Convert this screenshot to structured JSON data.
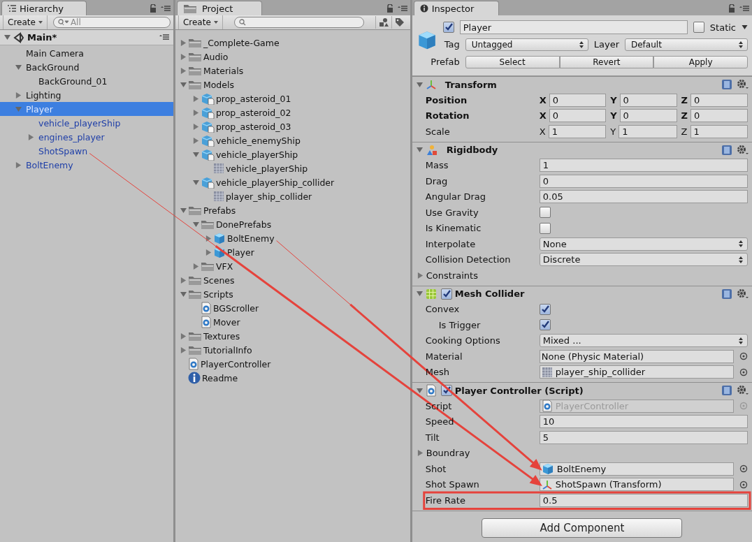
{
  "hierarchy": {
    "tab": "Hierarchy",
    "create": "Create",
    "search": {
      "placeholder": "All"
    },
    "scene": {
      "name": "Main*",
      "expanded": true
    },
    "items": [
      {
        "label": "Main Camera",
        "selected": false,
        "prefab": false
      },
      {
        "label": "BackGround",
        "expanded": true,
        "selected": false,
        "prefab": false,
        "children": [
          {
            "label": "BackGround_01",
            "selected": false,
            "prefab": false
          }
        ]
      },
      {
        "label": "Lighting",
        "expanded": false,
        "selected": false,
        "prefab": false
      },
      {
        "label": "Player",
        "expanded": true,
        "selected": true,
        "prefab": true,
        "children": [
          {
            "label": "vehicle_playerShip",
            "selected": false,
            "prefab": true
          },
          {
            "label": "engines_player",
            "expanded": false,
            "selected": false,
            "prefab": true
          },
          {
            "label": "ShotSpawn",
            "selected": false,
            "prefab": true,
            "arrow_source": true
          }
        ]
      },
      {
        "label": "BoltEnemy",
        "expanded": false,
        "selected": false,
        "prefab": true
      }
    ]
  },
  "project": {
    "tab": "Project",
    "create": "Create",
    "items": [
      {
        "label": "_Complete-Game",
        "kind": "folder",
        "expanded": false
      },
      {
        "label": "Audio",
        "kind": "folder",
        "expanded": false
      },
      {
        "label": "Materials",
        "kind": "folder",
        "expanded": false
      },
      {
        "label": "Models",
        "kind": "folder",
        "expanded": true,
        "children": [
          {
            "label": "prop_asteroid_01",
            "kind": "model",
            "expanded": false
          },
          {
            "label": "prop_asteroid_02",
            "kind": "model",
            "expanded": false
          },
          {
            "label": "prop_asteroid_03",
            "kind": "model",
            "expanded": false
          },
          {
            "label": "vehicle_enemyShip",
            "kind": "model",
            "expanded": false
          },
          {
            "label": "vehicle_playerShip",
            "kind": "model",
            "expanded": true,
            "children": [
              {
                "label": "vehicle_playerShip",
                "kind": "mesh"
              }
            ]
          },
          {
            "label": "vehicle_playerShip_collider",
            "kind": "model",
            "expanded": true,
            "children": [
              {
                "label": "player_ship_collider",
                "kind": "mesh"
              }
            ]
          }
        ]
      },
      {
        "label": "Prefabs",
        "kind": "folder",
        "expanded": true,
        "children": [
          {
            "label": "DonePrefabs",
            "kind": "folder",
            "expanded": true,
            "children": [
              {
                "label": "BoltEnemy",
                "kind": "prefab",
                "expanded": false,
                "arrow_source": true
              },
              {
                "label": "Player",
                "kind": "prefab",
                "expanded": false
              }
            ]
          },
          {
            "label": "VFX",
            "kind": "folder",
            "expanded": false
          }
        ]
      },
      {
        "label": "Scenes",
        "kind": "folder",
        "expanded": false
      },
      {
        "label": "Scripts",
        "kind": "folder",
        "expanded": true,
        "children": [
          {
            "label": "BGScroller",
            "kind": "script"
          },
          {
            "label": "Mover",
            "kind": "script"
          }
        ]
      },
      {
        "label": "Textures",
        "kind": "folder",
        "expanded": false
      },
      {
        "label": "TutorialInfo",
        "kind": "folder",
        "expanded": false
      },
      {
        "label": "PlayerController",
        "kind": "script"
      },
      {
        "label": "Readme",
        "kind": "info"
      }
    ]
  },
  "inspector": {
    "tab": "Inspector",
    "object": {
      "active": true,
      "name": "Player",
      "static": false,
      "static_label": "Static",
      "tag_label": "Tag",
      "tag": "Untagged",
      "layer_label": "Layer",
      "layer": "Default",
      "prefab_label": "Prefab",
      "prefab_buttons": [
        "Select",
        "Revert",
        "Apply"
      ]
    },
    "components": [
      {
        "name": "Transform",
        "kind": "transform",
        "expanded": true,
        "fields": [
          {
            "kind": "vector3",
            "label": "Position",
            "overridden": true,
            "values": [
              {
                "axis": "X",
                "value": "0"
              },
              {
                "axis": "Y",
                "value": "0"
              },
              {
                "axis": "Z",
                "value": "0"
              }
            ]
          },
          {
            "kind": "vector3",
            "label": "Rotation",
            "overridden": true,
            "values": [
              {
                "axis": "X",
                "value": "0"
              },
              {
                "axis": "Y",
                "value": "0"
              },
              {
                "axis": "Z",
                "value": "0"
              }
            ]
          },
          {
            "kind": "vector3",
            "label": "Scale",
            "overridden": false,
            "values": [
              {
                "axis": "X",
                "value": "1"
              },
              {
                "axis": "Y",
                "value": "1"
              },
              {
                "axis": "Z",
                "value": "1"
              }
            ]
          }
        ]
      },
      {
        "name": "Rigidbody",
        "kind": "rigidbody",
        "expanded": true,
        "fields": [
          {
            "kind": "text",
            "label": "Mass",
            "value": "1"
          },
          {
            "kind": "text",
            "label": "Drag",
            "value": "0"
          },
          {
            "kind": "text",
            "label": "Angular Drag",
            "value": "0.05"
          },
          {
            "kind": "checkbox",
            "label": "Use Gravity",
            "checked": false
          },
          {
            "kind": "checkbox",
            "label": "Is Kinematic",
            "checked": false
          },
          {
            "kind": "dropdown",
            "label": "Interpolate",
            "value": "None"
          },
          {
            "kind": "dropdown",
            "label": "Collision Detection",
            "value": "Discrete"
          },
          {
            "kind": "foldout",
            "label": "Constraints",
            "expanded": false
          }
        ]
      },
      {
        "name": "Mesh Collider",
        "kind": "mesh_collider",
        "enabled": true,
        "expanded": true,
        "fields": [
          {
            "kind": "checkbox",
            "label": "Convex",
            "checked": true,
            "children": [
              {
                "kind": "checkbox",
                "label": "Is Trigger",
                "checked": true
              }
            ]
          },
          {
            "kind": "dropdown",
            "label": "Cooking Options",
            "value": "Mixed ..."
          },
          {
            "kind": "object",
            "label": "Material",
            "value": "None (Physic Material)"
          },
          {
            "kind": "mesh_ref",
            "label": "Mesh",
            "value": "player_ship_collider"
          }
        ]
      },
      {
        "name": "Player Controller (Script)",
        "kind": "script",
        "enabled": true,
        "expanded": true,
        "fields": [
          {
            "kind": "script_ref",
            "label": "Script",
            "value": "PlayerController",
            "disabled": true
          },
          {
            "kind": "text",
            "label": "Speed",
            "value": "10"
          },
          {
            "kind": "text",
            "label": "Tilt",
            "value": "5"
          },
          {
            "kind": "foldout",
            "label": "Boundray",
            "expanded": false
          },
          {
            "kind": "prefab_ref",
            "label": "Shot",
            "value": "BoltEnemy",
            "arrow_from_project": true
          },
          {
            "kind": "transform_ref",
            "label": "Shot Spawn",
            "value": "ShotSpawn (Transform)",
            "arrow_from_hierarchy": true
          },
          {
            "kind": "text",
            "label": "Fire Rate",
            "value": "0.5",
            "highlighted": true
          }
        ]
      }
    ],
    "add_button": "Add Component"
  }
}
